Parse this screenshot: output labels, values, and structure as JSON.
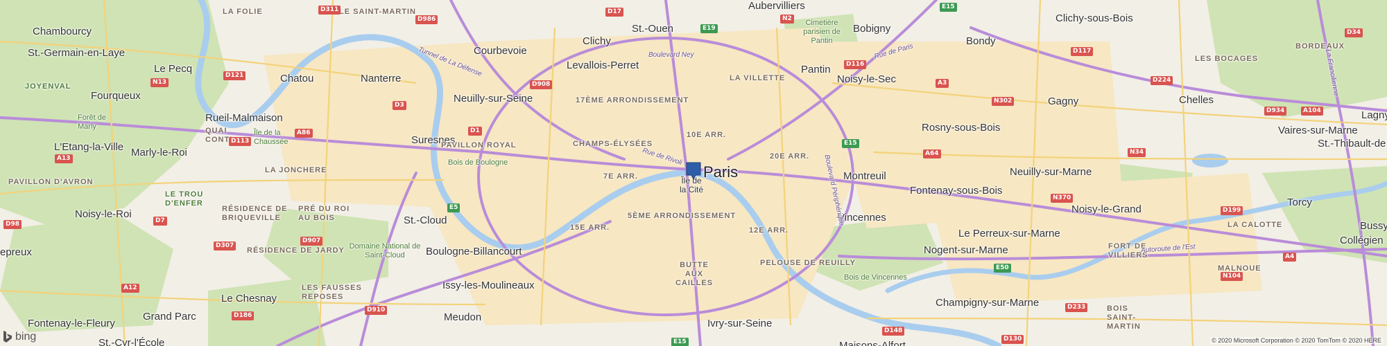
{
  "map": {
    "city_label": "Paris",
    "logo_text": "bing",
    "copyright": "© 2020 Microsoft Corporation © 2020 TomTom © 2020 HERE",
    "places": [
      {
        "id": "chambourcy",
        "label": "Chambourcy"
      },
      {
        "id": "st-germain",
        "label": "St.-Germain-en-Laye"
      },
      {
        "id": "le-pecq",
        "label": "Le Pecq"
      },
      {
        "id": "chatou",
        "label": "Chatou"
      },
      {
        "id": "nanterre",
        "label": "Nanterre"
      },
      {
        "id": "courbevoie",
        "label": "Courbevoie"
      },
      {
        "id": "clichy",
        "label": "Clichy"
      },
      {
        "id": "st-ouen",
        "label": "St.-Ouen"
      },
      {
        "id": "aubervilliers",
        "label": "Aubervilliers"
      },
      {
        "id": "bobigny",
        "label": "Bobigny"
      },
      {
        "id": "bondy",
        "label": "Bondy"
      },
      {
        "id": "clichy-sous-bois",
        "label": "Clichy-sous-Bois"
      },
      {
        "id": "levallois",
        "label": "Levallois-Perret"
      },
      {
        "id": "pantin",
        "label": "Pantin"
      },
      {
        "id": "noisy-le-sec",
        "label": "Noisy-le-Sec"
      },
      {
        "id": "fourqueux",
        "label": "Fourqueux"
      },
      {
        "id": "neuilly-sur-seine",
        "label": "Neuilly-sur-Seine"
      },
      {
        "id": "gagny",
        "label": "Gagny"
      },
      {
        "id": "chelles",
        "label": "Chelles"
      },
      {
        "id": "rueil",
        "label": "Rueil-Malmaison"
      },
      {
        "id": "lagny",
        "label": "Lagny"
      },
      {
        "id": "rosny",
        "label": "Rosny-sous-Bois"
      },
      {
        "id": "vaires",
        "label": "Vaires-sur-Marne"
      },
      {
        "id": "st-thibault",
        "label": "St.-Thibault-de"
      },
      {
        "id": "suresnes",
        "label": "Suresnes"
      },
      {
        "id": "etang-la-ville",
        "label": "L'Etang-la-Ville"
      },
      {
        "id": "marly-le-roi",
        "label": "Marly-le-Roi"
      },
      {
        "id": "montreuil",
        "label": "Montreuil"
      },
      {
        "id": "neuilly-sur-marne",
        "label": "Neuilly-sur-Marne"
      },
      {
        "id": "fontenay-sous-bois",
        "label": "Fontenay-sous-Bois"
      },
      {
        "id": "noisy-le-grand",
        "label": "Noisy-le-Grand"
      },
      {
        "id": "torcy",
        "label": "Torcy"
      },
      {
        "id": "noisy-le-roi",
        "label": "Noisy-le-Roi"
      },
      {
        "id": "st-cloud",
        "label": "St.-Cloud"
      },
      {
        "id": "vincennes",
        "label": "Vincennes"
      },
      {
        "id": "bussy",
        "label": "Bussy-"
      },
      {
        "id": "le-perreux",
        "label": "Le Perreux-sur-Marne"
      },
      {
        "id": "collegien",
        "label": "Collégien"
      },
      {
        "id": "nogent",
        "label": "Nogent-sur-Marne"
      },
      {
        "id": "epreux",
        "label": "epreux"
      },
      {
        "id": "boulogne",
        "label": "Boulogne-Billancourt"
      },
      {
        "id": "issy",
        "label": "Issy-les-Moulineaux"
      },
      {
        "id": "le-chesnay",
        "label": "Le Chesnay"
      },
      {
        "id": "champigny",
        "label": "Champigny-sur-Marne"
      },
      {
        "id": "meudon",
        "label": "Meudon"
      },
      {
        "id": "ivry",
        "label": "Ivry-sur-Seine"
      },
      {
        "id": "fontenay-le-fleury",
        "label": "Fontenay-le-Fleury"
      },
      {
        "id": "grand-parc",
        "label": "Grand Parc"
      },
      {
        "id": "st-cyr",
        "label": "St.-Cyr-l'École"
      },
      {
        "id": "maisons-alfort",
        "label": "Maisons-Alfort"
      },
      {
        "id": "lie-de-la-cite",
        "label": "Île de la Cité"
      }
    ],
    "districts": [
      {
        "id": "la-folie",
        "label": "LA FOLIE"
      },
      {
        "id": "ile-st-martin",
        "label": "ÎLE SAINT-MARTIN"
      },
      {
        "id": "la-villette",
        "label": "LA VILLETTE"
      },
      {
        "id": "17e",
        "label": "17ÈME ARRONDISSEMENT"
      },
      {
        "id": "10e",
        "label": "10E ARR."
      },
      {
        "id": "champs",
        "label": "CHAMPS-ÉLYSÉES"
      },
      {
        "id": "20e",
        "label": "20E ARR."
      },
      {
        "id": "7e",
        "label": "7E ARR."
      },
      {
        "id": "5e",
        "label": "5ÈME ARRONDISSEMENT"
      },
      {
        "id": "15e",
        "label": "15E ARR."
      },
      {
        "id": "12e",
        "label": "12E ARR."
      },
      {
        "id": "butte",
        "label": "BUTTE AUX CAILLES"
      },
      {
        "id": "joyenval",
        "label": "JOYENVAL"
      },
      {
        "id": "quai-conti",
        "label": "QUAI CONTI"
      },
      {
        "id": "pavillon-royal",
        "label": "PAVILLON ROYAL"
      },
      {
        "id": "la-joncheree",
        "label": "LA JONCHERE"
      },
      {
        "id": "pavillon-avron",
        "label": "PAVILLON D'AVRON"
      },
      {
        "id": "le-trou-denfer",
        "label": "LE TROU D'ENFER"
      },
      {
        "id": "residence-briqueville",
        "label": "RÉSIDENCE DE BRIQUEVILLE"
      },
      {
        "id": "pre-catelan",
        "label": "PRÉ DU ROI AU BOIS"
      },
      {
        "id": "residence-jardy",
        "label": "RÉSIDENCE DE JARDY"
      },
      {
        "id": "les-fausses-reposes",
        "label": "LES FAUSSES REPOSES"
      },
      {
        "id": "la-calotte",
        "label": "LA CALOTTE"
      },
      {
        "id": "malnoue",
        "label": "MALNOUE"
      },
      {
        "id": "fort-villiers",
        "label": "FORT DE VILLIERS"
      },
      {
        "id": "bois-st-martin",
        "label": "BOIS SAINT-MARTIN"
      },
      {
        "id": "les-bocages",
        "label": "LES BOCAGES"
      },
      {
        "id": "bordeaux",
        "label": "BORDEAUX"
      },
      {
        "id": "pelouse-reuilly",
        "label": "PELOUSE DE REUILLY"
      }
    ],
    "parks": [
      {
        "id": "bois-boulogne",
        "label": "Bois de Boulogne"
      },
      {
        "id": "bois-vincennes",
        "label": "Bois de Vincennes"
      },
      {
        "id": "domaine-st-cloud",
        "label": "Domaine National de Saint-Cloud"
      },
      {
        "id": "cimetiere-pantin",
        "label": "Cimetière parisien de Pantin"
      },
      {
        "id": "foret-marly",
        "label": "Forêt de Marly"
      },
      {
        "id": "ile-chaussee",
        "label": "Île de la Chaussée"
      }
    ],
    "roads": [
      {
        "id": "rue-rivoli",
        "label": "Rue de Rivoli"
      },
      {
        "id": "boulevard-ney",
        "label": "Boulevard Ney"
      },
      {
        "id": "rue-paris",
        "label": "Rue de Paris"
      },
      {
        "id": "tunnel-defense",
        "label": "Tunnel de La Défense"
      },
      {
        "id": "autoroute-est",
        "label": "Autoroute de l'Est"
      },
      {
        "id": "bd-peripherique",
        "label": "Boulevard Périphérique"
      },
      {
        "id": "la-francilienne",
        "label": "La Francilienne"
      }
    ],
    "shields": [
      {
        "id": "d311",
        "label": "D311"
      },
      {
        "id": "d986",
        "label": "D986"
      },
      {
        "id": "d17",
        "label": "D17"
      },
      {
        "id": "e19",
        "label": "E19"
      },
      {
        "id": "n2",
        "label": "N2"
      },
      {
        "id": "e15-n",
        "label": "E15"
      },
      {
        "id": "d34",
        "label": "D34"
      },
      {
        "id": "d121",
        "label": "D121"
      },
      {
        "id": "n13",
        "label": "N13"
      },
      {
        "id": "d908",
        "label": "D908"
      },
      {
        "id": "d116",
        "label": "D116"
      },
      {
        "id": "a3",
        "label": "A3"
      },
      {
        "id": "d117",
        "label": "D117"
      },
      {
        "id": "d224",
        "label": "D224"
      },
      {
        "id": "d3",
        "label": "D3"
      },
      {
        "id": "n302",
        "label": "N302"
      },
      {
        "id": "d934",
        "label": "D934"
      },
      {
        "id": "a104",
        "label": "A104"
      },
      {
        "id": "a86",
        "label": "A86"
      },
      {
        "id": "d1",
        "label": "D1"
      },
      {
        "id": "e15-c",
        "label": "E15"
      },
      {
        "id": "d113",
        "label": "D113"
      },
      {
        "id": "a64",
        "label": "A64"
      },
      {
        "id": "n34",
        "label": "N34"
      },
      {
        "id": "a13",
        "label": "A13"
      },
      {
        "id": "e5",
        "label": "E5"
      },
      {
        "id": "n370",
        "label": "N370"
      },
      {
        "id": "d7",
        "label": "D7"
      },
      {
        "id": "a4",
        "label": "A4"
      },
      {
        "id": "d199",
        "label": "D199"
      },
      {
        "id": "d98",
        "label": "D98"
      },
      {
        "id": "d907",
        "label": "D907"
      },
      {
        "id": "d307",
        "label": "D307"
      },
      {
        "id": "e50",
        "label": "E50"
      },
      {
        "id": "d233",
        "label": "D233"
      },
      {
        "id": "d910",
        "label": "D910"
      },
      {
        "id": "d148",
        "label": "D148"
      },
      {
        "id": "d186",
        "label": "D186"
      },
      {
        "id": "e15-s",
        "label": "E15"
      },
      {
        "id": "d130",
        "label": "D130"
      },
      {
        "id": "a12",
        "label": "A12"
      },
      {
        "id": "n104",
        "label": "N104"
      }
    ]
  }
}
